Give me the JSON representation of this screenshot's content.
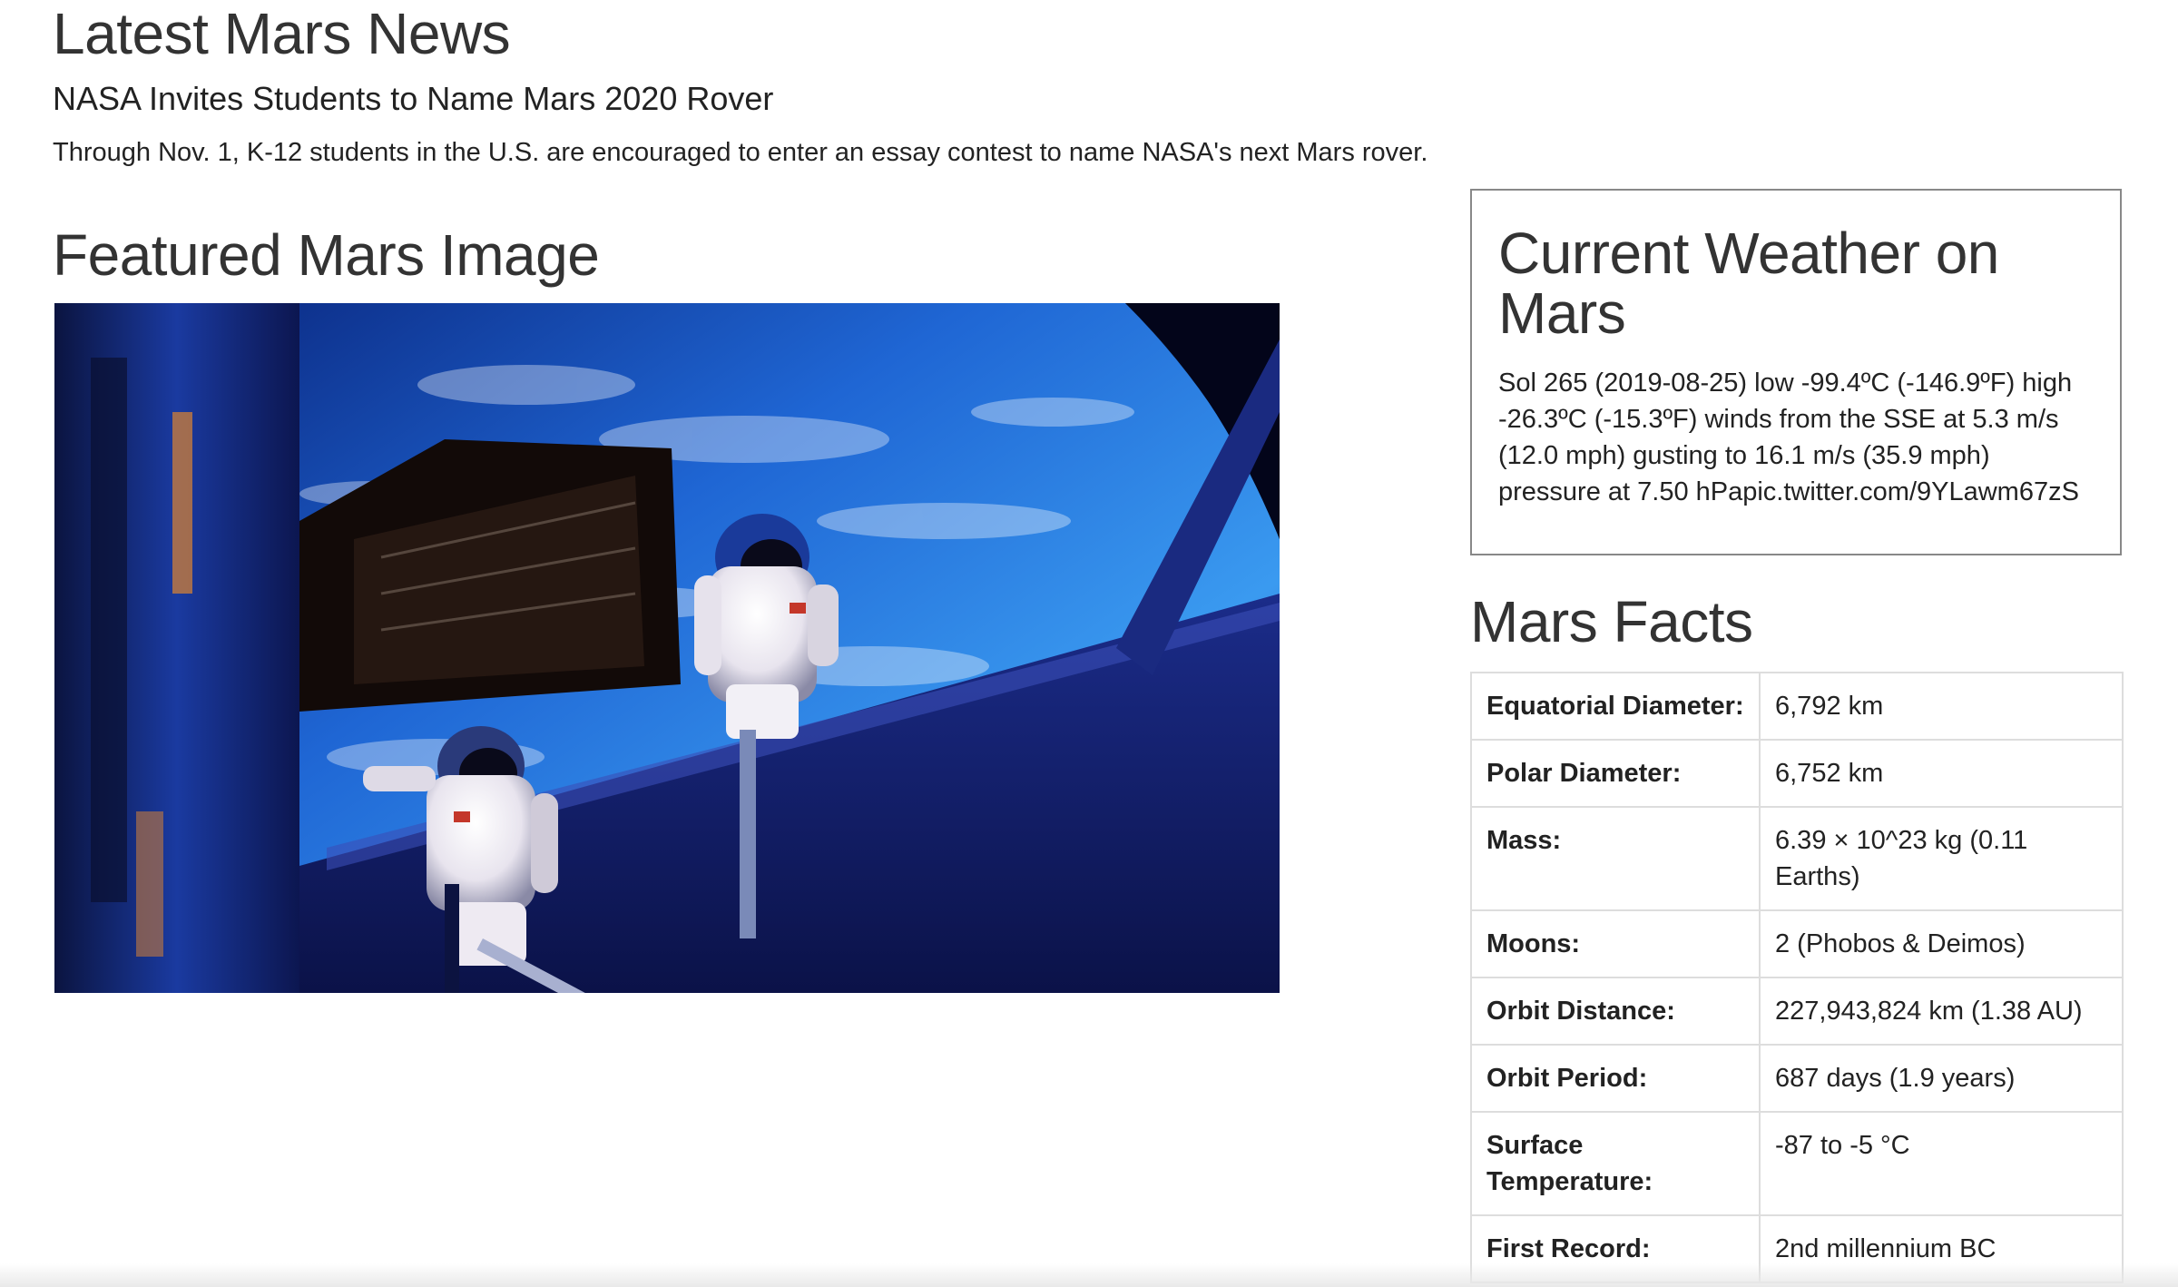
{
  "news": {
    "section_title": "Latest Mars News",
    "headline": "NASA Invites Students to Name Mars 2020 Rover",
    "teaser": "Through Nov. 1, K-12 students in the U.S. are encouraged to enter an essay contest to name NASA's next Mars rover."
  },
  "featured": {
    "section_title": "Featured Mars Image",
    "image_description_icon": "astronauts-spacewalk-image"
  },
  "weather": {
    "title": "Current Weather on Mars",
    "text": "Sol 265 (2019-08-25) low -99.4ºC (-146.9ºF) high -26.3ºC (-15.3ºF) winds from the SSE at 5.3 m/s (12.0 mph) gusting to 16.1 m/s (35.9 mph) pressure at 7.50 hPapic.twitter.com/9YLawm67zS"
  },
  "facts": {
    "title": "Mars Facts",
    "rows": [
      {
        "label": "Equatorial Diameter:",
        "value": "6,792 km"
      },
      {
        "label": "Polar Diameter:",
        "value": "6,752 km"
      },
      {
        "label": "Mass:",
        "value": "6.39 × 10^23 kg (0.11 Earths)"
      },
      {
        "label": "Moons:",
        "value": "2 (Phobos & Deimos)"
      },
      {
        "label": "Orbit Distance:",
        "value": "227,943,824 km (1.38 AU)"
      },
      {
        "label": "Orbit Period:",
        "value": "687 days (1.9 years)"
      },
      {
        "label": "Surface Temperature:",
        "value": "-87 to -5 °C"
      },
      {
        "label": "First Record:",
        "value": "2nd millennium BC"
      }
    ]
  },
  "colors": {
    "text": "#333333",
    "table_border": "#dddddd",
    "box_border": "#888888",
    "image_sky": "#1e6bd6",
    "image_dark": "#0a0d2a"
  }
}
